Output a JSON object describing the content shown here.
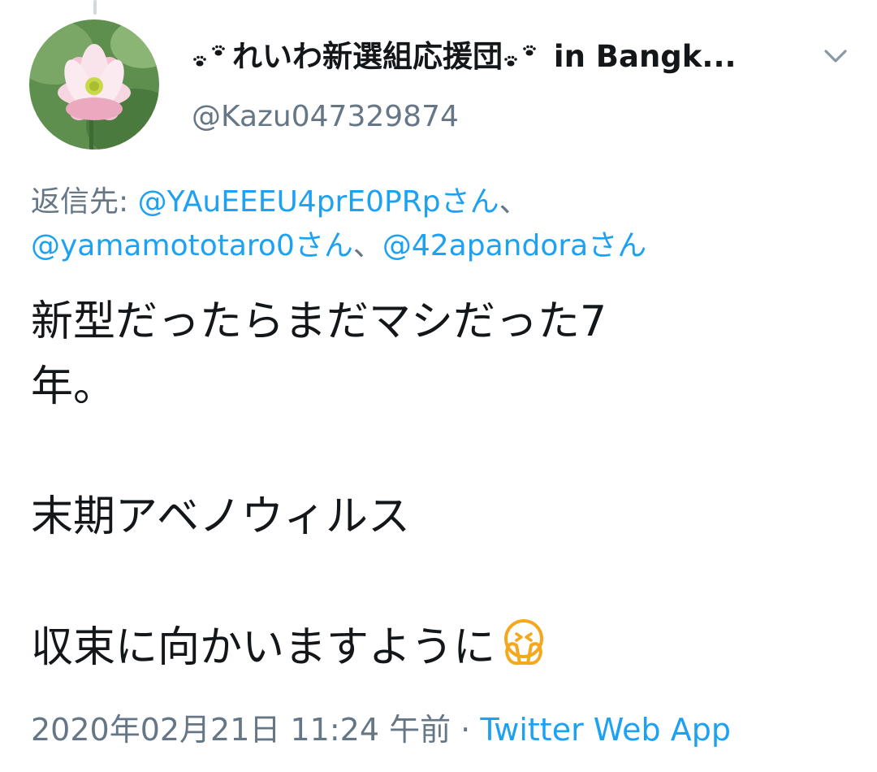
{
  "tweet": {
    "display_name": "れいわ新選組応援団",
    "display_name_suffix": " in Bangk...",
    "handle": "@Kazu047329874",
    "reply_prefix": "返信先: ",
    "reply_mentions": [
      "@YAuEEEU4prE0PRpさん",
      "@yamamototaro0さん",
      "@42apandoraさん"
    ],
    "reply_separator": "、",
    "text_lines": [
      "新型だったらまだマシだった7",
      "年。",
      "",
      "末期アベノウィルス",
      "",
      "収束に向かいますように"
    ],
    "timestamp": "2020年02月21日 11:24 午前",
    "separator": " · ",
    "source": "Twitter Web App"
  },
  "colors": {
    "link": "#1da1f2",
    "secondary_text": "#657786",
    "primary_text": "#14171a"
  },
  "icons": {
    "avatar": "lotus-flower-avatar",
    "name_decoration": "paw-prints-icon",
    "menu": "chevron-down-icon",
    "emoji": "face-in-hands-emoji"
  }
}
